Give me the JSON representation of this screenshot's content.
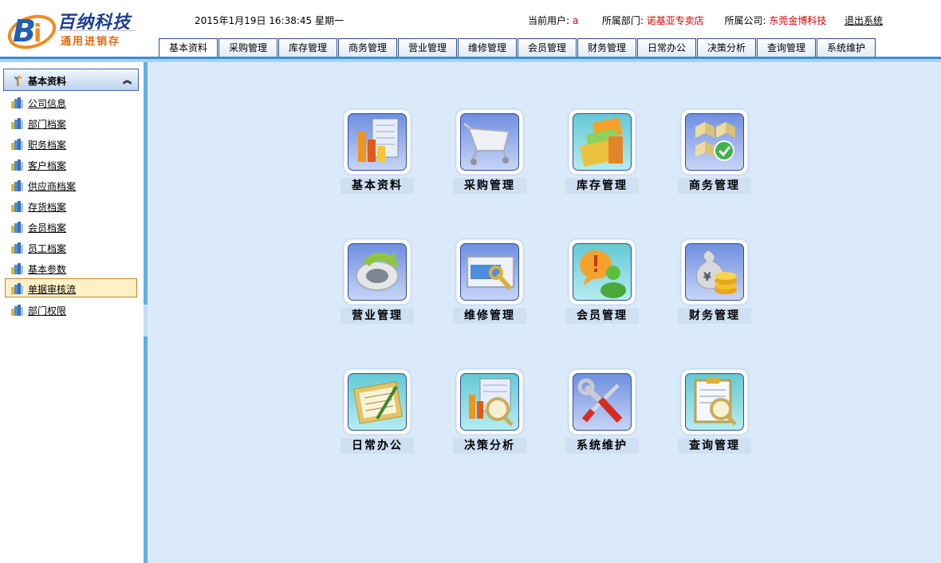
{
  "header": {
    "logo_title": "百纳科技",
    "logo_subtitle": "通用进销存",
    "datetime": "2015年1月19日 16:38:45 星期一",
    "current_user_label": "当前用户:",
    "current_user_value": "a",
    "department_label": "所属部门:",
    "department_value": "诺基亚专卖店",
    "company_label": "所属公司:",
    "company_value": "东莞金博科技",
    "logout_label": "退出系统"
  },
  "tabs": [
    {
      "label": "基本资料",
      "active": true
    },
    {
      "label": "采购管理"
    },
    {
      "label": "库存管理"
    },
    {
      "label": "商务管理"
    },
    {
      "label": "营业管理"
    },
    {
      "label": "维修管理"
    },
    {
      "label": "会员管理"
    },
    {
      "label": "财务管理"
    },
    {
      "label": "日常办公"
    },
    {
      "label": "决策分析"
    },
    {
      "label": "查询管理"
    },
    {
      "label": "系统维护"
    }
  ],
  "sidebar": {
    "title": "基本资料",
    "collapse_icon": "double-chevron-up-icon",
    "items": [
      {
        "label": "公司信息"
      },
      {
        "label": "部门档案"
      },
      {
        "label": "职务档案"
      },
      {
        "label": "客户档案"
      },
      {
        "label": "供应商档案"
      },
      {
        "label": "存货档案"
      },
      {
        "label": "会员档案"
      },
      {
        "label": "员工档案"
      },
      {
        "label": "基本参数"
      },
      {
        "label": "单据审核流",
        "active": true
      },
      {
        "label": "部门权限"
      }
    ]
  },
  "modules": [
    {
      "label": "基本资料",
      "icon": "bar-chart-icon"
    },
    {
      "label": "采购管理",
      "icon": "shopping-cart-icon"
    },
    {
      "label": "库存管理",
      "icon": "stacked-files-icon"
    },
    {
      "label": "商务管理",
      "icon": "boxes-check-icon"
    },
    {
      "label": "营业管理",
      "icon": "refresh-arrow-icon"
    },
    {
      "label": "维修管理",
      "icon": "card-wrench-icon"
    },
    {
      "label": "会员管理",
      "icon": "member-alert-icon"
    },
    {
      "label": "财务管理",
      "icon": "money-coins-icon"
    },
    {
      "label": "日常办公",
      "icon": "clipboard-pen-icon"
    },
    {
      "label": "决策分析",
      "icon": "chart-magnifier-icon"
    },
    {
      "label": "系统维护",
      "icon": "tools-icon"
    },
    {
      "label": "查询管理",
      "icon": "document-search-icon"
    }
  ],
  "colors": {
    "accent": "#3d8fd0",
    "main_bg": "#dbeafa",
    "value_red": "#dd0000",
    "logo_blue": "#1b3f93",
    "logo_orange": "#e06a10",
    "active_item_bg": "#fff0c8"
  }
}
